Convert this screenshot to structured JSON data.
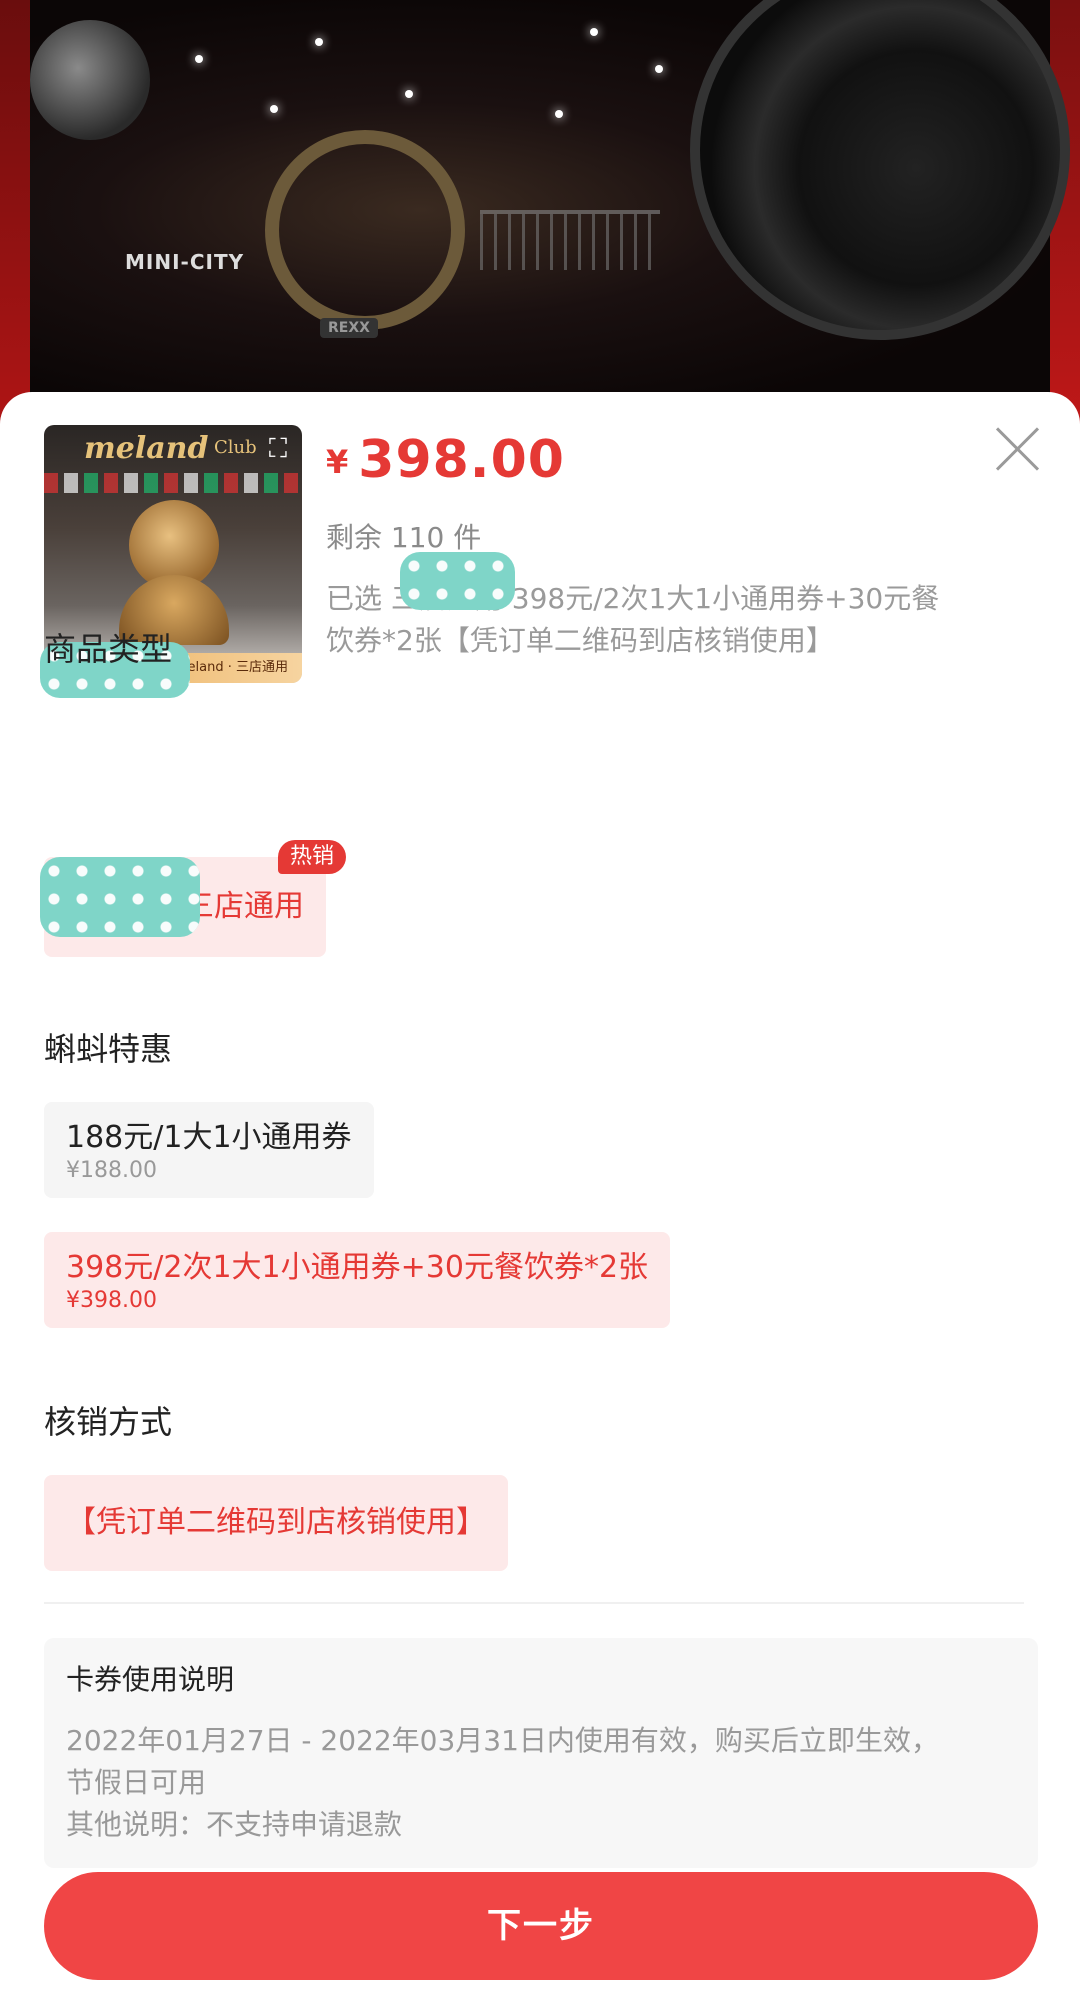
{
  "background": {
    "sign_text": "MINI-CITY",
    "small_sign_text": "REXX"
  },
  "product": {
    "thumbnail": {
      "brand": "meland",
      "brand_suffix": "Club",
      "tag": "Meland · 三店通用"
    },
    "currency": "¥",
    "price": "398.00",
    "stock_text": "剩余  110  件",
    "selected_text": "已选          三店通用 398元/2次1大1小通用券+30元餐饮券*2张【凭订单二维码到店核销使用】"
  },
  "sections": {
    "product_type": {
      "title": "商品类型",
      "option_label": "三店通用",
      "badge": "热销"
    },
    "deals": {
      "title": "蝌蚪特惠",
      "options": [
        {
          "label": "188元/1大1小通用券",
          "price": "¥188.00",
          "selected": false
        },
        {
          "label": "398元/2次1大1小通用券+30元餐饮券*2张",
          "price": "¥398.00",
          "selected": true
        }
      ]
    },
    "redeem": {
      "title": "核销方式",
      "option_label": "【凭订单二维码到店核销使用】"
    }
  },
  "usage_note": {
    "title": "卡券使用说明",
    "line1": "2022年01月27日 - 2022年03月31日内使用有效，购买后立即生效，",
    "line2": "节假日可用",
    "line3": "其他说明：不支持申请退款"
  },
  "actions": {
    "next_label": "下一步"
  },
  "colors": {
    "accent": "#e53935",
    "button": "#f04545",
    "chip_selected_bg": "#fde9e9"
  }
}
